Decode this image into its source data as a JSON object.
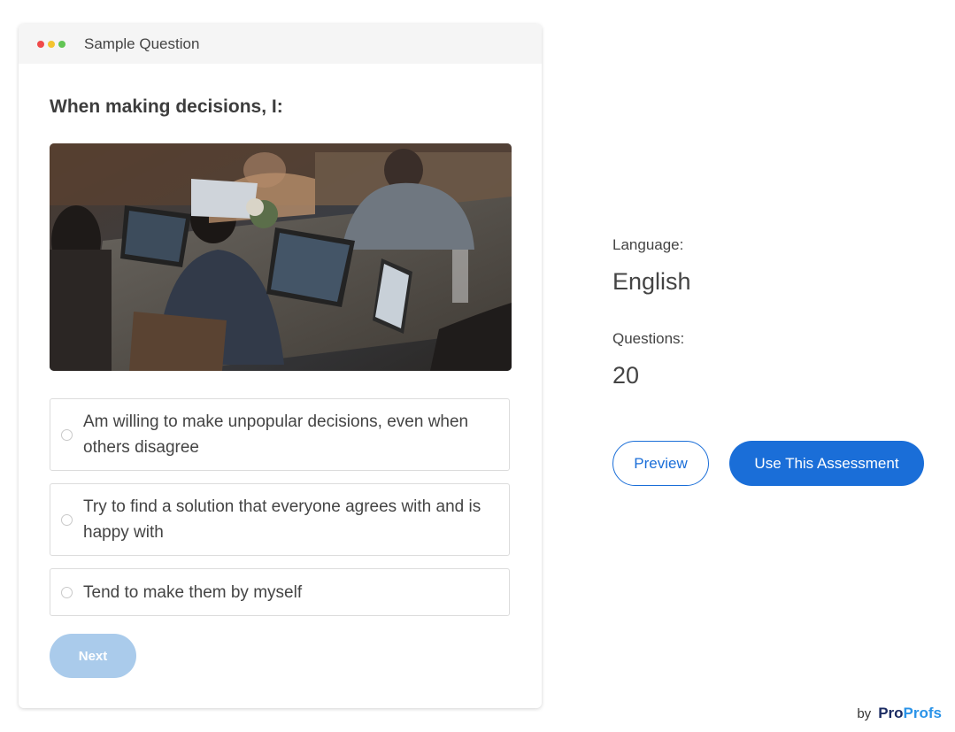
{
  "card": {
    "header_title": "Sample Question",
    "window_dots": [
      "#f04a4a",
      "#f4c430",
      "#62c554"
    ],
    "question": "When making decisions, I:",
    "options": [
      {
        "text": "Am willing to make unpopular decisions, even when others disagree"
      },
      {
        "text": "Try to find a solution that everyone agrees with and is happy with"
      },
      {
        "text": "Tend to make them by myself"
      }
    ],
    "next_label": "Next"
  },
  "info": {
    "language_label": "Language:",
    "language_value": "English",
    "questions_label": "Questions:",
    "questions_value": "20"
  },
  "actions": {
    "preview_label": "Preview",
    "use_label": "Use This Assessment"
  },
  "footer": {
    "by": "by",
    "brand_part1": "Pro",
    "brand_part2": "Profs"
  },
  "colors": {
    "accent": "#1a6ed8",
    "next_disabled": "#aacbeb"
  }
}
